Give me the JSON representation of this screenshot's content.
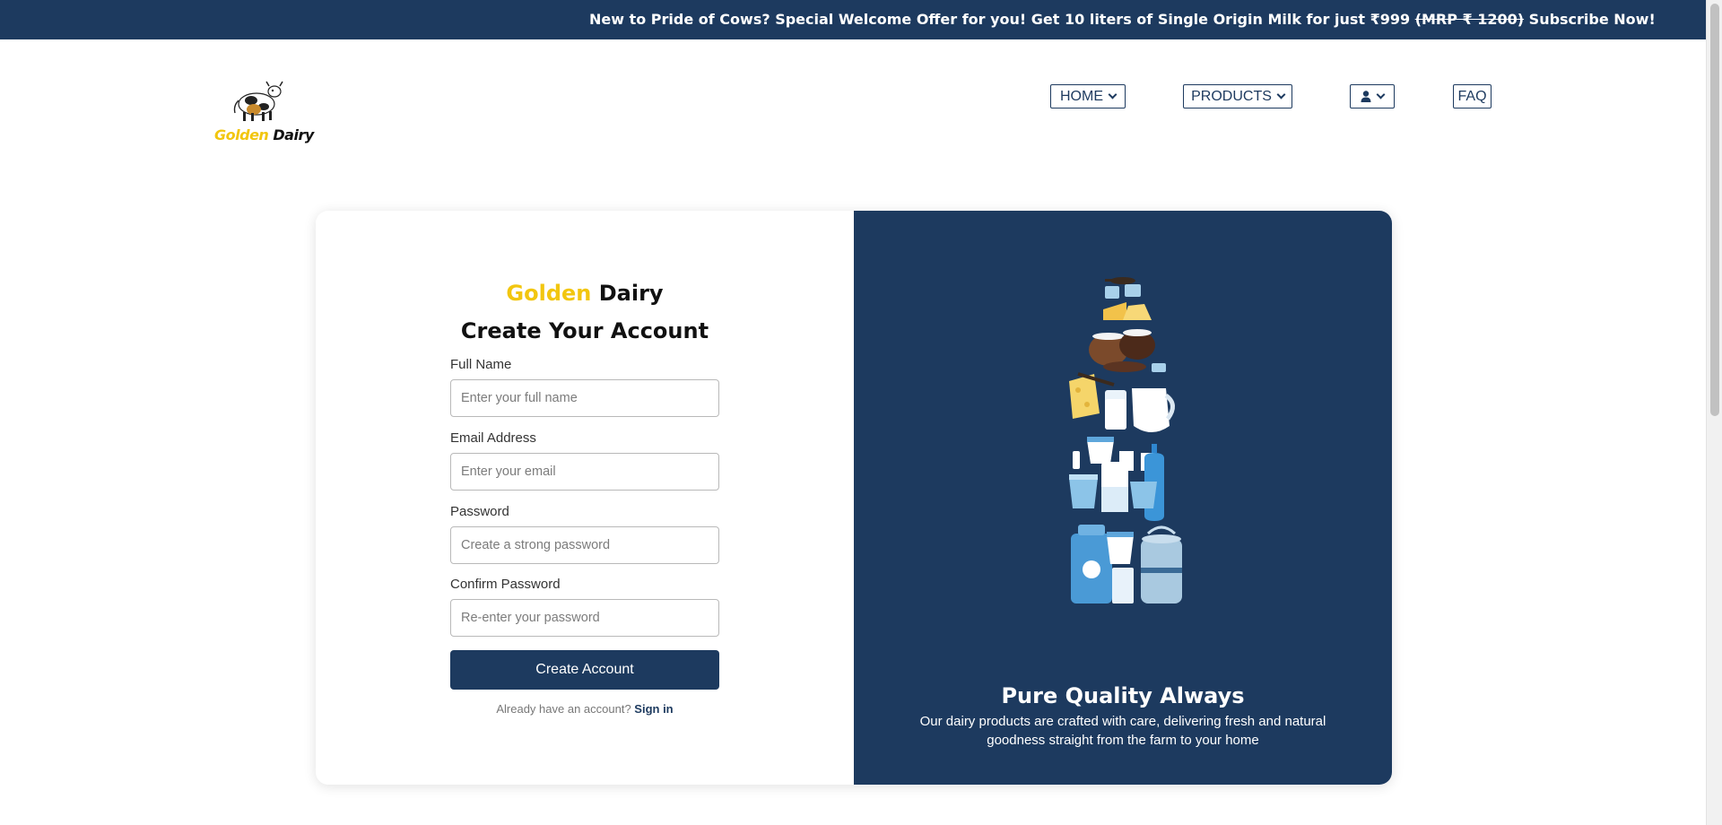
{
  "announcement": {
    "text_before": "New to Pride of Cows? Special Welcome Offer for you! Get 10 liters of Single Origin Milk for just ₹999 ",
    "text_strike": "(MRP ₹ 1200)",
    "text_after": " Subscribe Now!"
  },
  "brand": {
    "part1": "Golden",
    "part2": "Dairy"
  },
  "nav": {
    "home": "HOME",
    "products": "PRODUCTS",
    "faq": "FAQ"
  },
  "form": {
    "title": "Create Your Account",
    "full_name": {
      "label": "Full Name",
      "placeholder": "Enter your full name",
      "value": ""
    },
    "email": {
      "label": "Email Address",
      "placeholder": "Enter your email",
      "value": ""
    },
    "password": {
      "label": "Password",
      "placeholder": "Create a strong password",
      "value": ""
    },
    "confirm_password": {
      "label": "Confirm Password",
      "placeholder": "Re-enter your password",
      "value": ""
    },
    "submit_label": "Create Account",
    "signin_prompt": "Already have an account?",
    "signin_link": "Sign in"
  },
  "promo": {
    "title": "Pure Quality Always",
    "description": "Our dairy products are crafted with care, delivering fresh and natural goodness straight from the farm to your home"
  },
  "icons": {
    "nav_user": "user-icon",
    "nav_chevron": "chevron-down-icon",
    "logo": "cow-logo-icon"
  },
  "colors": {
    "primary_navy": "#1d3a5f",
    "brand_gold": "#f2c60f",
    "white": "#ffffff"
  }
}
